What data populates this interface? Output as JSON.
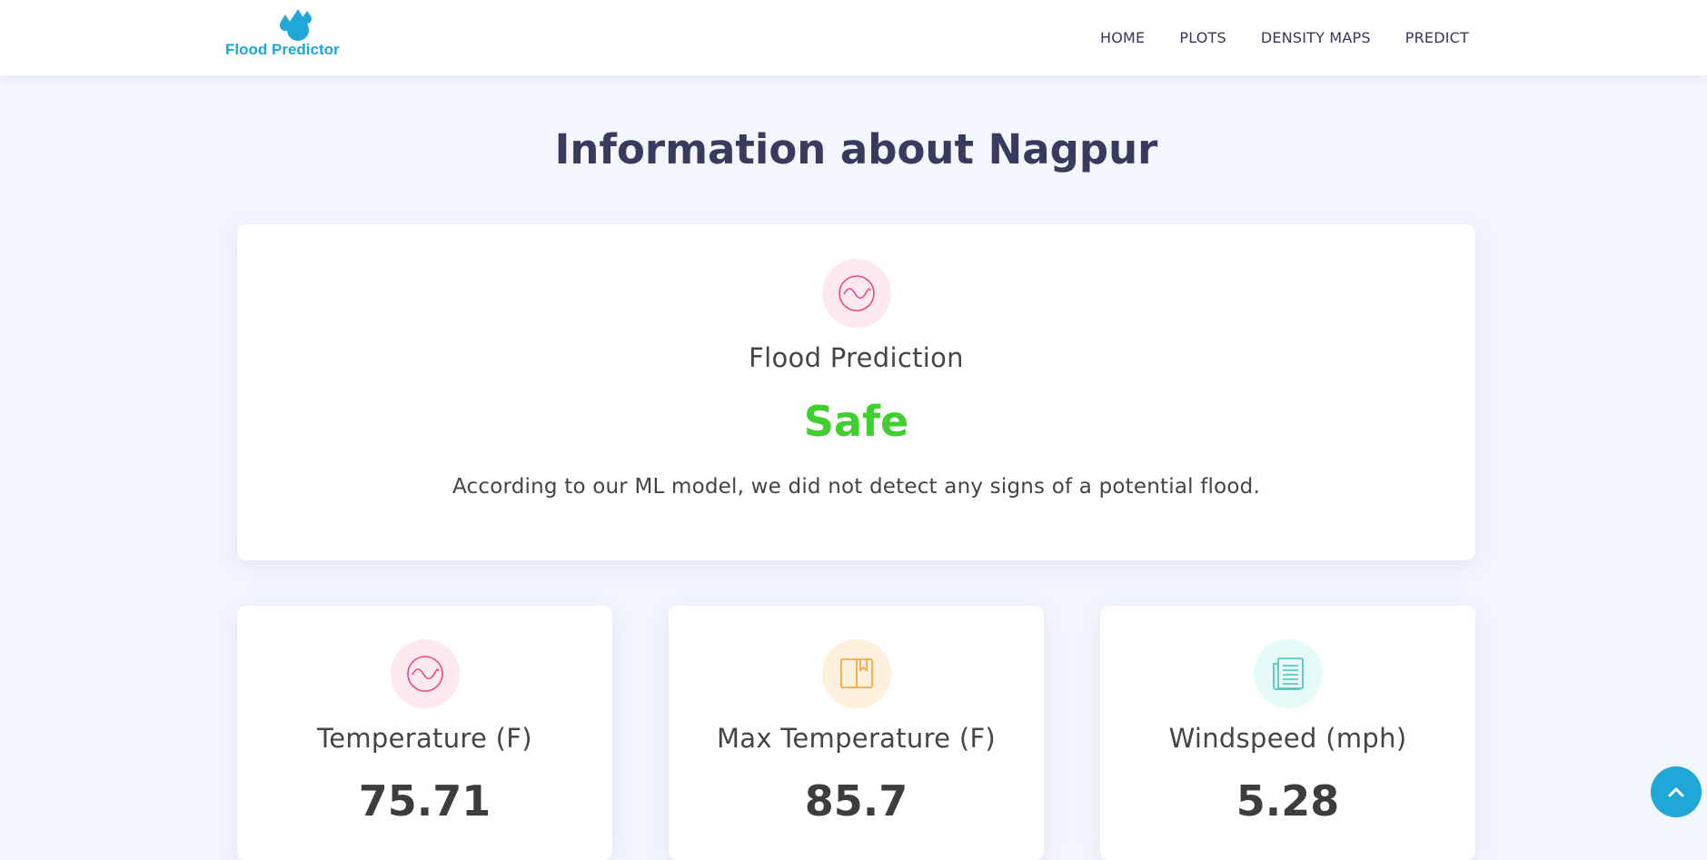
{
  "brand": {
    "name": "Flood Predictor",
    "color": "#1ea7d7"
  },
  "nav": [
    {
      "label": "HOME"
    },
    {
      "label": "PLOTS"
    },
    {
      "label": "DENSITY MAPS"
    },
    {
      "label": "PREDICT"
    }
  ],
  "page": {
    "title": "Information about Nagpur"
  },
  "prediction": {
    "icon": "wave-icon",
    "label": "Flood Prediction",
    "status": "Safe",
    "status_color": "#3fcf2e",
    "description": "According to our ML model, we did not detect any signs of a potential flood."
  },
  "stats": [
    {
      "icon": "wave-icon",
      "label": "Temperature (F)",
      "value": "75.71",
      "icon_bg": "#fde9ef",
      "icon_color": "#e94b80"
    },
    {
      "icon": "book-icon",
      "label": "Max Temperature (F)",
      "value": "85.7",
      "icon_bg": "#fff0dd",
      "icon_color": "#f2a132"
    },
    {
      "icon": "document-icon",
      "label": "Windspeed (mph)",
      "value": "5.28",
      "icon_bg": "#e6fbf8",
      "icon_color": "#3ec4b6"
    }
  ],
  "back_to_top": {
    "icon": "chevron-up-icon"
  }
}
